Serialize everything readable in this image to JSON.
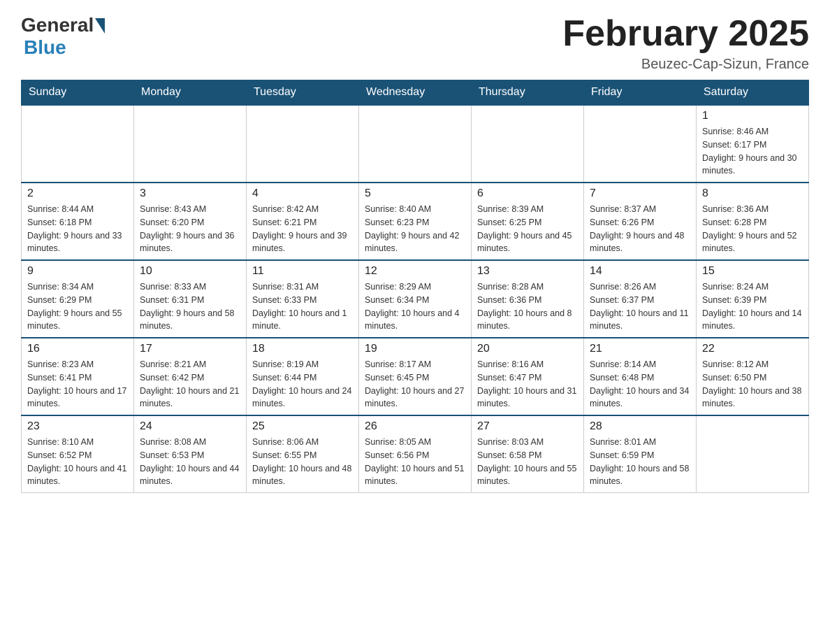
{
  "logo": {
    "general": "General",
    "blue": "Blue"
  },
  "title": "February 2025",
  "location": "Beuzec-Cap-Sizun, France",
  "days_of_week": [
    "Sunday",
    "Monday",
    "Tuesday",
    "Wednesday",
    "Thursday",
    "Friday",
    "Saturday"
  ],
  "weeks": [
    [
      {
        "day": "",
        "sunrise": "",
        "sunset": "",
        "daylight": ""
      },
      {
        "day": "",
        "sunrise": "",
        "sunset": "",
        "daylight": ""
      },
      {
        "day": "",
        "sunrise": "",
        "sunset": "",
        "daylight": ""
      },
      {
        "day": "",
        "sunrise": "",
        "sunset": "",
        "daylight": ""
      },
      {
        "day": "",
        "sunrise": "",
        "sunset": "",
        "daylight": ""
      },
      {
        "day": "",
        "sunrise": "",
        "sunset": "",
        "daylight": ""
      },
      {
        "day": "1",
        "sunrise": "Sunrise: 8:46 AM",
        "sunset": "Sunset: 6:17 PM",
        "daylight": "Daylight: 9 hours and 30 minutes."
      }
    ],
    [
      {
        "day": "2",
        "sunrise": "Sunrise: 8:44 AM",
        "sunset": "Sunset: 6:18 PM",
        "daylight": "Daylight: 9 hours and 33 minutes."
      },
      {
        "day": "3",
        "sunrise": "Sunrise: 8:43 AM",
        "sunset": "Sunset: 6:20 PM",
        "daylight": "Daylight: 9 hours and 36 minutes."
      },
      {
        "day": "4",
        "sunrise": "Sunrise: 8:42 AM",
        "sunset": "Sunset: 6:21 PM",
        "daylight": "Daylight: 9 hours and 39 minutes."
      },
      {
        "day": "5",
        "sunrise": "Sunrise: 8:40 AM",
        "sunset": "Sunset: 6:23 PM",
        "daylight": "Daylight: 9 hours and 42 minutes."
      },
      {
        "day": "6",
        "sunrise": "Sunrise: 8:39 AM",
        "sunset": "Sunset: 6:25 PM",
        "daylight": "Daylight: 9 hours and 45 minutes."
      },
      {
        "day": "7",
        "sunrise": "Sunrise: 8:37 AM",
        "sunset": "Sunset: 6:26 PM",
        "daylight": "Daylight: 9 hours and 48 minutes."
      },
      {
        "day": "8",
        "sunrise": "Sunrise: 8:36 AM",
        "sunset": "Sunset: 6:28 PM",
        "daylight": "Daylight: 9 hours and 52 minutes."
      }
    ],
    [
      {
        "day": "9",
        "sunrise": "Sunrise: 8:34 AM",
        "sunset": "Sunset: 6:29 PM",
        "daylight": "Daylight: 9 hours and 55 minutes."
      },
      {
        "day": "10",
        "sunrise": "Sunrise: 8:33 AM",
        "sunset": "Sunset: 6:31 PM",
        "daylight": "Daylight: 9 hours and 58 minutes."
      },
      {
        "day": "11",
        "sunrise": "Sunrise: 8:31 AM",
        "sunset": "Sunset: 6:33 PM",
        "daylight": "Daylight: 10 hours and 1 minute."
      },
      {
        "day": "12",
        "sunrise": "Sunrise: 8:29 AM",
        "sunset": "Sunset: 6:34 PM",
        "daylight": "Daylight: 10 hours and 4 minutes."
      },
      {
        "day": "13",
        "sunrise": "Sunrise: 8:28 AM",
        "sunset": "Sunset: 6:36 PM",
        "daylight": "Daylight: 10 hours and 8 minutes."
      },
      {
        "day": "14",
        "sunrise": "Sunrise: 8:26 AM",
        "sunset": "Sunset: 6:37 PM",
        "daylight": "Daylight: 10 hours and 11 minutes."
      },
      {
        "day": "15",
        "sunrise": "Sunrise: 8:24 AM",
        "sunset": "Sunset: 6:39 PM",
        "daylight": "Daylight: 10 hours and 14 minutes."
      }
    ],
    [
      {
        "day": "16",
        "sunrise": "Sunrise: 8:23 AM",
        "sunset": "Sunset: 6:41 PM",
        "daylight": "Daylight: 10 hours and 17 minutes."
      },
      {
        "day": "17",
        "sunrise": "Sunrise: 8:21 AM",
        "sunset": "Sunset: 6:42 PM",
        "daylight": "Daylight: 10 hours and 21 minutes."
      },
      {
        "day": "18",
        "sunrise": "Sunrise: 8:19 AM",
        "sunset": "Sunset: 6:44 PM",
        "daylight": "Daylight: 10 hours and 24 minutes."
      },
      {
        "day": "19",
        "sunrise": "Sunrise: 8:17 AM",
        "sunset": "Sunset: 6:45 PM",
        "daylight": "Daylight: 10 hours and 27 minutes."
      },
      {
        "day": "20",
        "sunrise": "Sunrise: 8:16 AM",
        "sunset": "Sunset: 6:47 PM",
        "daylight": "Daylight: 10 hours and 31 minutes."
      },
      {
        "day": "21",
        "sunrise": "Sunrise: 8:14 AM",
        "sunset": "Sunset: 6:48 PM",
        "daylight": "Daylight: 10 hours and 34 minutes."
      },
      {
        "day": "22",
        "sunrise": "Sunrise: 8:12 AM",
        "sunset": "Sunset: 6:50 PM",
        "daylight": "Daylight: 10 hours and 38 minutes."
      }
    ],
    [
      {
        "day": "23",
        "sunrise": "Sunrise: 8:10 AM",
        "sunset": "Sunset: 6:52 PM",
        "daylight": "Daylight: 10 hours and 41 minutes."
      },
      {
        "day": "24",
        "sunrise": "Sunrise: 8:08 AM",
        "sunset": "Sunset: 6:53 PM",
        "daylight": "Daylight: 10 hours and 44 minutes."
      },
      {
        "day": "25",
        "sunrise": "Sunrise: 8:06 AM",
        "sunset": "Sunset: 6:55 PM",
        "daylight": "Daylight: 10 hours and 48 minutes."
      },
      {
        "day": "26",
        "sunrise": "Sunrise: 8:05 AM",
        "sunset": "Sunset: 6:56 PM",
        "daylight": "Daylight: 10 hours and 51 minutes."
      },
      {
        "day": "27",
        "sunrise": "Sunrise: 8:03 AM",
        "sunset": "Sunset: 6:58 PM",
        "daylight": "Daylight: 10 hours and 55 minutes."
      },
      {
        "day": "28",
        "sunrise": "Sunrise: 8:01 AM",
        "sunset": "Sunset: 6:59 PM",
        "daylight": "Daylight: 10 hours and 58 minutes."
      },
      {
        "day": "",
        "sunrise": "",
        "sunset": "",
        "daylight": ""
      }
    ]
  ]
}
